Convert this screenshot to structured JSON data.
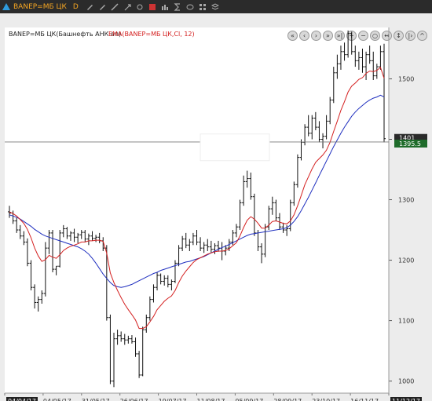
{
  "window": {
    "ticker": "BANEP=MБ ЦК",
    "timeframe": "D"
  },
  "legend": {
    "series_label": "BANEP=MБ ЦК(Башнефть АНК ап)",
    "ema_label": "EMA(BANEP=MБ ЦК,Cl, 12)"
  },
  "chart_data": {
    "type": "bar",
    "ylim": [
      980,
      1585
    ],
    "ytick_values": [
      1000,
      1100,
      1200,
      1300,
      1400,
      1500
    ],
    "ytick_labels": [
      "1000",
      "1100",
      "1200",
      "1300",
      "1400",
      "1500"
    ],
    "xtick_labels": [
      "04/04/17",
      "04/05/17",
      "31/05/17",
      "26/06/17",
      "19/07/17",
      "11/08/17",
      "05/09/17",
      "28/09/17",
      "23/10/17",
      "16/11/17",
      "11/12/17"
    ],
    "last_value_labels": [
      "1401",
      "1395.5"
    ],
    "ohlc": [
      [
        1280,
        1290,
        1270,
        1278
      ],
      [
        1278,
        1282,
        1260,
        1265
      ],
      [
        1265,
        1270,
        1245,
        1250
      ],
      [
        1250,
        1258,
        1235,
        1240
      ],
      [
        1240,
        1248,
        1225,
        1230
      ],
      [
        1230,
        1236,
        1190,
        1195
      ],
      [
        1195,
        1200,
        1150,
        1155
      ],
      [
        1155,
        1160,
        1120,
        1130
      ],
      [
        1130,
        1140,
        1115,
        1135
      ],
      [
        1135,
        1150,
        1128,
        1145
      ],
      [
        1145,
        1230,
        1140,
        1220
      ],
      [
        1220,
        1250,
        1210,
        1245
      ],
      [
        1245,
        1250,
        1180,
        1185
      ],
      [
        1185,
        1190,
        1175,
        1190
      ],
      [
        1190,
        1250,
        1188,
        1245
      ],
      [
        1245,
        1258,
        1238,
        1252
      ],
      [
        1252,
        1255,
        1235,
        1240
      ],
      [
        1240,
        1248,
        1232,
        1245
      ],
      [
        1245,
        1252,
        1230,
        1238
      ],
      [
        1238,
        1245,
        1228,
        1242
      ],
      [
        1242,
        1250,
        1235,
        1246
      ],
      [
        1246,
        1250,
        1230,
        1235
      ],
      [
        1235,
        1244,
        1225,
        1240
      ],
      [
        1240,
        1248,
        1232,
        1236
      ],
      [
        1236,
        1242,
        1230,
        1238
      ],
      [
        1238,
        1245,
        1228,
        1232
      ],
      [
        1232,
        1238,
        1215,
        1220
      ],
      [
        1220,
        1225,
        1100,
        1105
      ],
      [
        1105,
        1110,
        995,
        1000
      ],
      [
        1000,
        1080,
        990,
        1070
      ],
      [
        1070,
        1085,
        1060,
        1075
      ],
      [
        1075,
        1082,
        1065,
        1070
      ],
      [
        1070,
        1078,
        1060,
        1068
      ],
      [
        1068,
        1075,
        1062,
        1070
      ],
      [
        1070,
        1076,
        1062,
        1065
      ],
      [
        1065,
        1072,
        1040,
        1045
      ],
      [
        1045,
        1050,
        1005,
        1010
      ],
      [
        1010,
        1090,
        1008,
        1085
      ],
      [
        1085,
        1110,
        1080,
        1105
      ],
      [
        1105,
        1140,
        1100,
        1135
      ],
      [
        1135,
        1160,
        1130,
        1155
      ],
      [
        1155,
        1180,
        1150,
        1175
      ],
      [
        1175,
        1178,
        1160,
        1165
      ],
      [
        1165,
        1175,
        1158,
        1170
      ],
      [
        1170,
        1175,
        1155,
        1160
      ],
      [
        1160,
        1168,
        1150,
        1165
      ],
      [
        1165,
        1200,
        1162,
        1195
      ],
      [
        1195,
        1225,
        1190,
        1220
      ],
      [
        1220,
        1240,
        1215,
        1235
      ],
      [
        1235,
        1245,
        1220,
        1225
      ],
      [
        1225,
        1235,
        1215,
        1230
      ],
      [
        1230,
        1245,
        1225,
        1240
      ],
      [
        1240,
        1250,
        1225,
        1230
      ],
      [
        1230,
        1238,
        1215,
        1220
      ],
      [
        1220,
        1230,
        1212,
        1225
      ],
      [
        1225,
        1235,
        1215,
        1222
      ],
      [
        1222,
        1232,
        1212,
        1218
      ],
      [
        1218,
        1228,
        1210,
        1224
      ],
      [
        1224,
        1232,
        1214,
        1220
      ],
      [
        1220,
        1230,
        1200,
        1215
      ],
      [
        1215,
        1225,
        1208,
        1220
      ],
      [
        1220,
        1235,
        1215,
        1230
      ],
      [
        1230,
        1250,
        1225,
        1245
      ],
      [
        1245,
        1260,
        1238,
        1255
      ],
      [
        1255,
        1300,
        1250,
        1295
      ],
      [
        1295,
        1340,
        1290,
        1330
      ],
      [
        1330,
        1348,
        1320,
        1335
      ],
      [
        1335,
        1345,
        1300,
        1305
      ],
      [
        1305,
        1310,
        1240,
        1245
      ],
      [
        1245,
        1250,
        1215,
        1222
      ],
      [
        1222,
        1228,
        1195,
        1210
      ],
      [
        1210,
        1260,
        1205,
        1255
      ],
      [
        1255,
        1290,
        1250,
        1285
      ],
      [
        1285,
        1305,
        1275,
        1295
      ],
      [
        1295,
        1300,
        1265,
        1270
      ],
      [
        1270,
        1278,
        1250,
        1255
      ],
      [
        1255,
        1262,
        1245,
        1250
      ],
      [
        1250,
        1258,
        1240,
        1252
      ],
      [
        1252,
        1300,
        1248,
        1295
      ],
      [
        1295,
        1330,
        1290,
        1325
      ],
      [
        1325,
        1375,
        1320,
        1370
      ],
      [
        1370,
        1400,
        1365,
        1395
      ],
      [
        1395,
        1425,
        1390,
        1420
      ],
      [
        1420,
        1440,
        1405,
        1410
      ],
      [
        1410,
        1440,
        1400,
        1435
      ],
      [
        1435,
        1445,
        1415,
        1420
      ],
      [
        1420,
        1430,
        1395,
        1400
      ],
      [
        1400,
        1410,
        1385,
        1405
      ],
      [
        1405,
        1440,
        1400,
        1430
      ],
      [
        1430,
        1470,
        1425,
        1465
      ],
      [
        1465,
        1520,
        1460,
        1510
      ],
      [
        1510,
        1540,
        1500,
        1525
      ],
      [
        1525,
        1555,
        1515,
        1545
      ],
      [
        1545,
        1560,
        1530,
        1540
      ],
      [
        1540,
        1580,
        1535,
        1575
      ],
      [
        1575,
        1578,
        1540,
        1545
      ],
      [
        1545,
        1555,
        1520,
        1530
      ],
      [
        1530,
        1545,
        1515,
        1535
      ],
      [
        1535,
        1550,
        1510,
        1520
      ],
      [
        1520,
        1545,
        1498,
        1540
      ],
      [
        1540,
        1555,
        1525,
        1530
      ],
      [
        1530,
        1545,
        1498,
        1505
      ],
      [
        1505,
        1525,
        1500,
        1520
      ],
      [
        1520,
        1555,
        1515,
        1545
      ],
      [
        1545,
        1558,
        1395,
        1401
      ]
    ],
    "ema12": [
      1280,
      1277,
      1273,
      1267,
      1261,
      1251,
      1237,
      1220,
      1207,
      1198,
      1201,
      1208,
      1205,
      1203,
      1209,
      1216,
      1220,
      1223,
      1225,
      1227,
      1230,
      1230,
      1232,
      1232,
      1233,
      1233,
      1231,
      1212,
      1179,
      1163,
      1150,
      1138,
      1127,
      1118,
      1110,
      1101,
      1087,
      1087,
      1090,
      1098,
      1107,
      1118,
      1125,
      1132,
      1137,
      1141,
      1150,
      1163,
      1174,
      1182,
      1189,
      1196,
      1201,
      1204,
      1207,
      1210,
      1212,
      1214,
      1215,
      1215,
      1216,
      1219,
      1224,
      1229,
      1240,
      1254,
      1266,
      1272,
      1268,
      1261,
      1253,
      1253,
      1258,
      1264,
      1265,
      1263,
      1261,
      1260,
      1265,
      1275,
      1290,
      1307,
      1325,
      1338,
      1351,
      1362,
      1368,
      1374,
      1382,
      1395,
      1413,
      1430,
      1448,
      1462,
      1478,
      1488,
      1493,
      1499,
      1502,
      1509,
      1513,
      1512,
      1514,
      1519,
      1501
    ],
    "sma50": [
      1275,
      1273,
      1271,
      1268,
      1264,
      1260,
      1256,
      1251,
      1247,
      1243,
      1240,
      1238,
      1236,
      1234,
      1232,
      1230,
      1228,
      1226,
      1224,
      1222,
      1219,
      1215,
      1210,
      1203,
      1195,
      1186,
      1177,
      1170,
      1163,
      1158,
      1156,
      1155,
      1156,
      1158,
      1160,
      1163,
      1166,
      1169,
      1172,
      1175,
      1178,
      1180,
      1183,
      1185,
      1187,
      1189,
      1191,
      1193,
      1195,
      1197,
      1198,
      1200,
      1202,
      1204,
      1206,
      1209,
      1212,
      1215,
      1218,
      1221,
      1223,
      1226,
      1229,
      1232,
      1235,
      1238,
      1241,
      1243,
      1244,
      1245,
      1246,
      1247,
      1248,
      1249,
      1250,
      1251,
      1252,
      1254,
      1258,
      1264,
      1272,
      1282,
      1293,
      1304,
      1316,
      1328,
      1340,
      1352,
      1364,
      1376,
      1388,
      1399,
      1410,
      1420,
      1429,
      1438,
      1445,
      1451,
      1456,
      1461,
      1465,
      1468,
      1470,
      1473,
      1470
    ]
  },
  "colors": {
    "background": "#ffffff",
    "frame": "#ececec",
    "bars": "#111111",
    "ema": "#d42020",
    "sma": "#1f2fbf",
    "titlebar": "#2b2b2b",
    "title_text": "#f5a623",
    "last_price_box": "#1e6b2a"
  },
  "toolbar": {
    "nav_buttons": [
      "first-icon",
      "back-icon",
      "play-icon",
      "forward-icon",
      "last-icon",
      "zoom-in-icon",
      "zoom-out-icon",
      "zoom-fit-icon",
      "zoom-width-icon",
      "fit-height-icon",
      "end-icon",
      "collapse-icon"
    ]
  }
}
